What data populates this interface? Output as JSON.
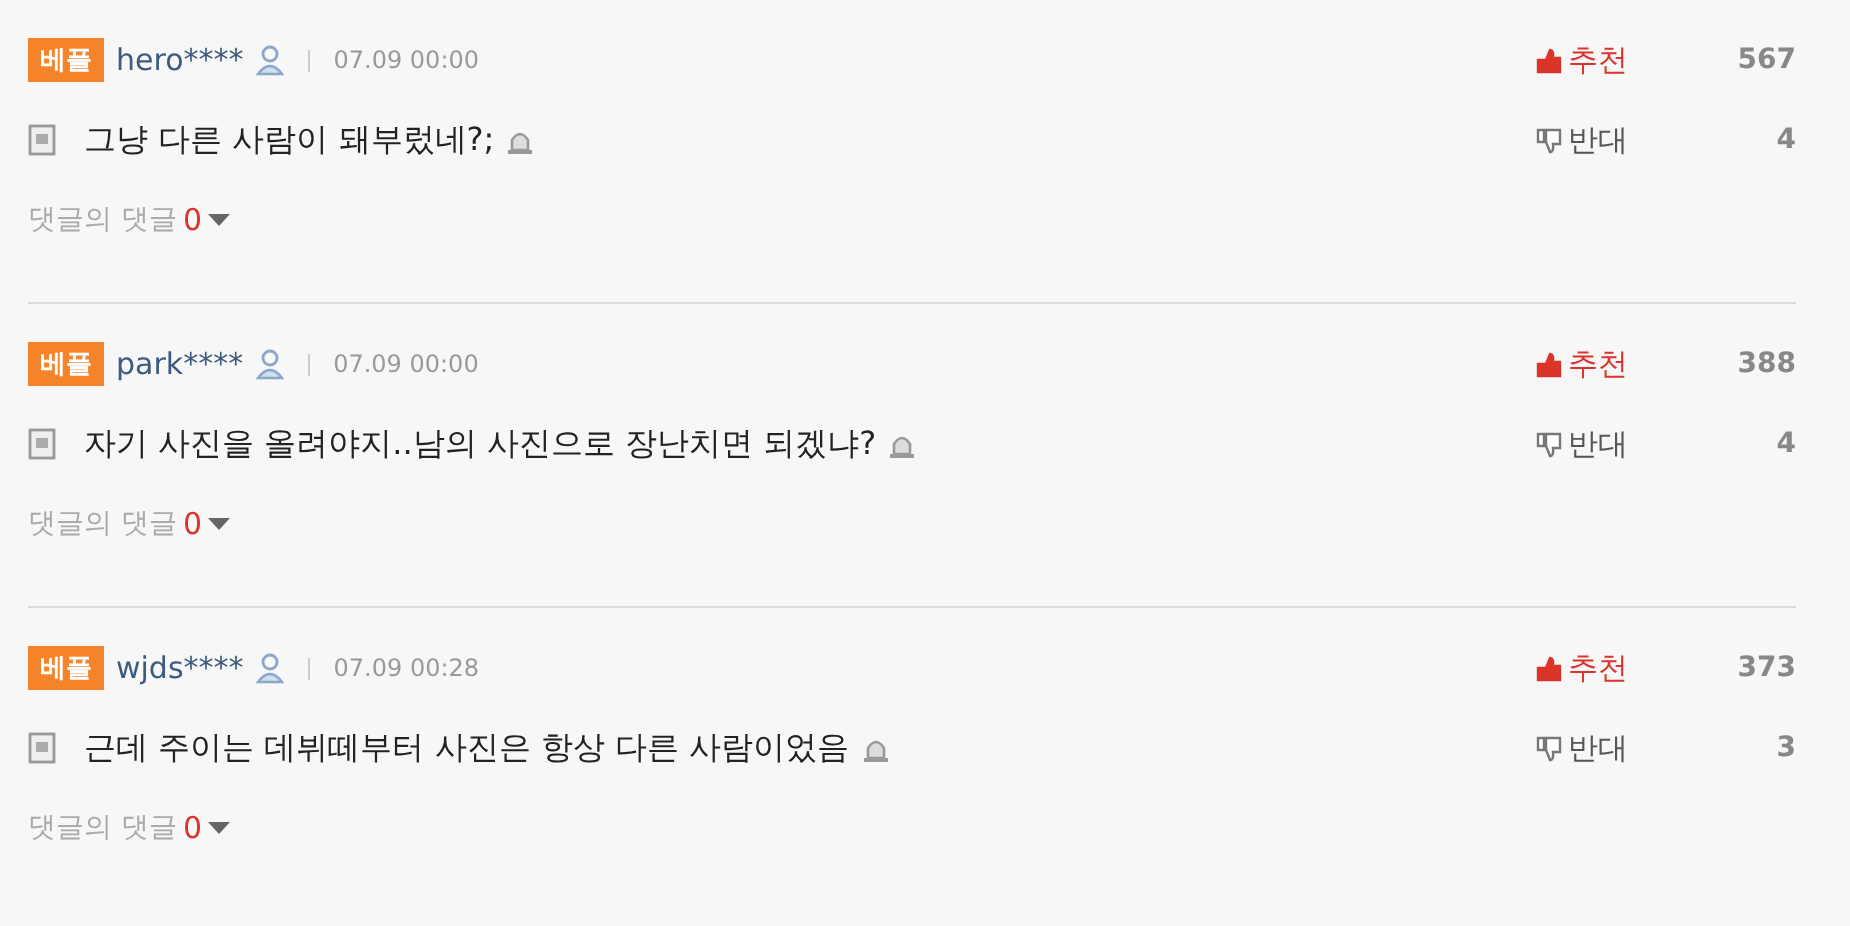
{
  "comments": [
    {
      "badge": "베플",
      "user": "hero****",
      "time": "07.09 00:00",
      "text": "그냥 다른 사람이 돼부렀네?;",
      "like_label": "추천",
      "likes": "567",
      "dislike_label": "반대",
      "dislikes": "4",
      "replies_label": "댓글의 댓글",
      "replies": "0"
    },
    {
      "badge": "베플",
      "user": "park****",
      "time": "07.09 00:00",
      "text": "자기 사진을 올려야지..남의 사진으로 장난치면 되겠냐?",
      "like_label": "추천",
      "likes": "388",
      "dislike_label": "반대",
      "dislikes": "4",
      "replies_label": "댓글의 댓글",
      "replies": "0"
    },
    {
      "badge": "베플",
      "user": "wjds****",
      "time": "07.09 00:28",
      "text": "근데 주이는 데뷔떼부터 사진은 항상 다른 사람이었음",
      "like_label": "추천",
      "likes": "373",
      "dislike_label": "반대",
      "dislikes": "3",
      "replies_label": "댓글의 댓글",
      "replies": "0"
    }
  ]
}
